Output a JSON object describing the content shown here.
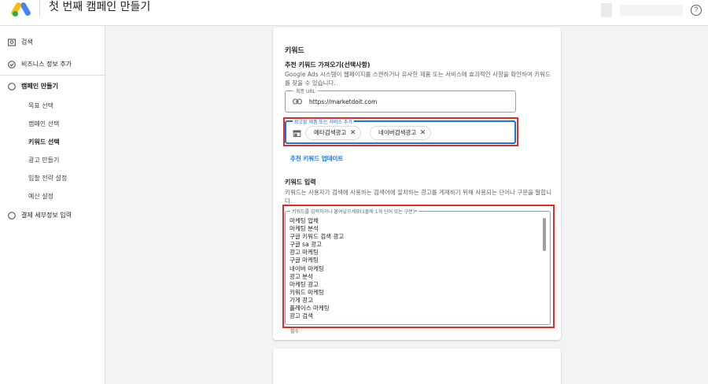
{
  "header": {
    "title": "첫 번째 캠페인 만들기",
    "help_icon": "help-icon"
  },
  "sidebar": {
    "items": [
      {
        "label": "검색",
        "icon": "search-icon"
      },
      {
        "label": "비즈니스 정보 추가",
        "icon": "check-circle-icon"
      },
      {
        "label": "캠페인 만들기",
        "icon": "circle-icon"
      },
      {
        "label": "결제 세부정보 입력",
        "icon": "circle-icon"
      }
    ],
    "sub_items": [
      "목표 선택",
      "캠페인 선택",
      "키워드 선택",
      "광고 만들기",
      "입찰 전략 설정",
      "예산 설정"
    ],
    "active_sub": "키워드 선택"
  },
  "main": {
    "section_title": "키워드",
    "import_title": "추천 키워드 가져오기(선택사항)",
    "import_desc": "Google Ads 시스템이 웹페이지를 스캔하거나 유사한 제품 또는 서비스에 효과적인 사항을 확인하여 키워드를 찾을 수 있습니다.",
    "url_field": {
      "label": "최종 URL",
      "value": "https://marketdoit.com",
      "icon": "link-icon"
    },
    "product_field": {
      "label": "광고할 제품 또는 서비스 추가",
      "icon": "store-icon",
      "chips": [
        "메타검색광고",
        "네이버검색광고"
      ]
    },
    "update_link": "추천 키워드 업데이트",
    "keyword_title": "키워드 입력",
    "keyword_desc": "키워드는 사용자가 검색에 사용하는 검색어에 일치하는 광고를 게재하기 위해 사용되는 단어나 구문을 말합니다.",
    "keyword_field": {
      "label": "키워드를 입력하거나 붙여넣으세요(1줄에 1개 단어 또는 구문)*",
      "lines": [
        "마케팅 업체",
        "마케팅 분석",
        "구글 키워드 검색 광고",
        "구글 sa 광고",
        "광고 마케팅",
        "구글 마케팅",
        "네이버 마케팅",
        "광고 분석",
        "마케팅 광고",
        "키워드 마케팅",
        "가게 광고",
        "플레이스 마케팅",
        "광고 검색"
      ]
    },
    "required_note": "필수"
  },
  "colors": {
    "accent": "#1a73e8",
    "highlight": "#d93025"
  }
}
